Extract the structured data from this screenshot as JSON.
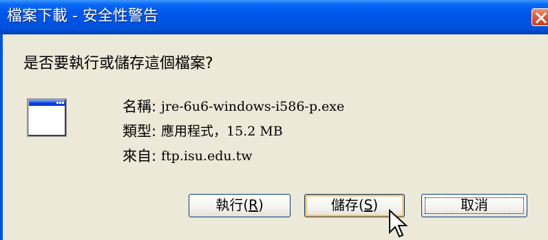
{
  "titlebar": {
    "title": "檔案下載 - 安全性警告"
  },
  "dialog": {
    "question": "是否要執行或儲存這個檔案?",
    "file_icon": "application-window-icon",
    "name": {
      "label": "名稱:",
      "value": "jre-6u6-windows-i586-p.exe"
    },
    "type": {
      "label": "類型:",
      "value": "應用程式，15.2 MB"
    },
    "from": {
      "label": "來自:",
      "value": "ftp.isu.edu.tw"
    }
  },
  "buttons": {
    "run": {
      "text": "執行",
      "open_paren": "(",
      "mnemonic": "R",
      "close_paren": ")"
    },
    "save": {
      "text": "儲存",
      "open_paren": "(",
      "mnemonic": "S",
      "close_paren": ")"
    },
    "cancel": {
      "text": "取消"
    }
  },
  "colors": {
    "titlebar_blue": "#0054E3",
    "dialog_background": "#ECE9D8",
    "close_button_red": "#E0593A",
    "save_hover_border": "#F8B75A"
  }
}
